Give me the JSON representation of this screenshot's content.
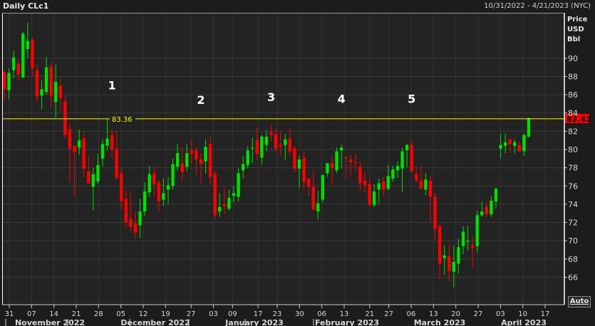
{
  "header": {
    "title": "Daily CLc1",
    "range": "10/31/2022 - 4/21/2023 (NYC)"
  },
  "controls": {
    "auto_label": "Auto"
  },
  "chart_data": {
    "type": "candlestick",
    "title": "Daily CLc1",
    "ylabel": [
      "Price",
      "USD",
      "Bbl"
    ],
    "ylim": [
      64.5,
      92.5
    ],
    "yticks": [
      66,
      68,
      70,
      72,
      74,
      76,
      78,
      80,
      82,
      84,
      86,
      88,
      90
    ],
    "grid": true,
    "colors": {
      "up": "#00e000",
      "down": "#ff0000",
      "hline": "#ffff00",
      "last_price_bg": "#ff0000"
    },
    "xtick_days_from_start": [
      0,
      7,
      14,
      21,
      28,
      35,
      42,
      49,
      57,
      64,
      70,
      78,
      84,
      91,
      98,
      105,
      113,
      119,
      126,
      133,
      140,
      147,
      154,
      161,
      168
    ],
    "xtick_labels": [
      "31",
      "07",
      "14",
      "21",
      "28",
      "05",
      "12",
      "19",
      "27",
      "03",
      "09",
      "17",
      "23",
      "30",
      "06",
      "13",
      "21",
      "27",
      "06",
      "13",
      "20",
      "27",
      "03",
      "10",
      "17"
    ],
    "months": [
      "November 2022",
      "December 2022",
      "January 2023",
      "February 2023",
      "March 2023",
      "April 2023"
    ],
    "hline": {
      "value": 83.36,
      "label": "83.36"
    },
    "last_price": {
      "value": 83.43,
      "label": "83.43"
    },
    "annotations": [
      {
        "text": "1",
        "candle": 23,
        "price": 86.6
      },
      {
        "text": "2",
        "candle": 42,
        "price": 85.0
      },
      {
        "text": "3",
        "candle": 57,
        "price": 85.3
      },
      {
        "text": "4",
        "candle": 72,
        "price": 85.1
      },
      {
        "text": "5",
        "candle": 87,
        "price": 85.1
      }
    ],
    "ohlc_fields": [
      "open",
      "high",
      "low",
      "close"
    ],
    "candles": [
      [
        88.5,
        88.7,
        85.3,
        86.6
      ],
      [
        86.5,
        88.9,
        85.5,
        88.4
      ],
      [
        88.7,
        90.8,
        87.8,
        90.1
      ],
      [
        89.4,
        89.9,
        87.5,
        88.2
      ],
      [
        87.9,
        92.9,
        87.8,
        92.7
      ],
      [
        91,
        93.9,
        90,
        91.9
      ],
      [
        92,
        92.3,
        88,
        88.9
      ],
      [
        88.7,
        89.3,
        85.3,
        85.8
      ],
      [
        85.9,
        87.6,
        84.4,
        86.6
      ],
      [
        86.3,
        90.1,
        86,
        89
      ],
      [
        89.1,
        89.6,
        84.6,
        85.9
      ],
      [
        85.2,
        89.3,
        83.5,
        87.4
      ],
      [
        87,
        87.7,
        84.2,
        85.6
      ],
      [
        85.3,
        86,
        81.2,
        81.6
      ],
      [
        82.2,
        82.9,
        76.4,
        80.1
      ],
      [
        80.4,
        80.4,
        74.8,
        79.7
      ],
      [
        80.2,
        82.2,
        79.4,
        81
      ],
      [
        81.2,
        82,
        77,
        77.9
      ],
      [
        77.6,
        79.2,
        76.2,
        76.3
      ],
      [
        75.9,
        78,
        73.3,
        77.3
      ],
      [
        76.5,
        79.5,
        76.2,
        78.3
      ],
      [
        79,
        81.1,
        78.2,
        80.6
      ],
      [
        80.4,
        83.36,
        79.9,
        81.2
      ],
      [
        81.6,
        82.2,
        79,
        80
      ],
      [
        80.1,
        82.1,
        76.7,
        76.9
      ],
      [
        77.4,
        78,
        73.4,
        74.3
      ],
      [
        74.6,
        75.5,
        71.5,
        72
      ],
      [
        72.4,
        75.5,
        70.9,
        71.5
      ],
      [
        71.9,
        73.2,
        70.2,
        70.9
      ],
      [
        71.7,
        74.6,
        70.3,
        73.2
      ],
      [
        73.2,
        76.4,
        72.7,
        75.4
      ],
      [
        75.3,
        78.2,
        74.8,
        77.3
      ],
      [
        77.4,
        78.2,
        74.8,
        76.2
      ],
      [
        76.4,
        76.7,
        73.2,
        74.3
      ],
      [
        74.5,
        76.8,
        73.8,
        75.2
      ],
      [
        75.6,
        77,
        74,
        76.1
      ],
      [
        76,
        79,
        75.6,
        78.4
      ],
      [
        78.1,
        80.6,
        77.7,
        79.6
      ],
      [
        78.5,
        80.3,
        76.6,
        77.5
      ],
      [
        78.1,
        80.6,
        77.6,
        79.6
      ],
      [
        79.9,
        81,
        78.5,
        79.5
      ],
      [
        79.9,
        80.2,
        77.2,
        78.9
      ],
      [
        78.9,
        79.6,
        76.2,
        78.4
      ],
      [
        78.7,
        81.1,
        77.4,
        80.3
      ],
      [
        80.6,
        81.4,
        76.2,
        77
      ],
      [
        77.3,
        77.7,
        72.4,
        72.8
      ],
      [
        73.2,
        75.2,
        72.6,
        73.7
      ],
      [
        74,
        75.8,
        72.9,
        73.8
      ],
      [
        73.5,
        75.6,
        73.3,
        74.7
      ],
      [
        74.9,
        76,
        74.2,
        75.2
      ],
      [
        74.8,
        78,
        74.3,
        77.4
      ],
      [
        77.7,
        79.3,
        76.8,
        78.4
      ],
      [
        78.3,
        80.4,
        77.9,
        79.9
      ],
      [
        80.1,
        81.3,
        78.5,
        80.2
      ],
      [
        81,
        82.4,
        78.9,
        79.5
      ],
      [
        79.1,
        81.6,
        78.4,
        81.4
      ],
      [
        80.5,
        82.1,
        79.8,
        81.4
      ],
      [
        81.9,
        82.7,
        80.9,
        81.6
      ],
      [
        81.7,
        82.3,
        79.6,
        80.1
      ],
      [
        80.5,
        82.1,
        79.3,
        80.3
      ],
      [
        80.5,
        81.7,
        78.8,
        81.1
      ],
      [
        81.2,
        82.2,
        79.4,
        79.8
      ],
      [
        80.1,
        80.4,
        77.5,
        77.9
      ],
      [
        77.9,
        79.3,
        75.8,
        78.9
      ],
      [
        79.1,
        79.7,
        75.6,
        76.4
      ],
      [
        76.8,
        76.9,
        74.9,
        75.9
      ],
      [
        75.9,
        77.6,
        73.3,
        73.4
      ],
      [
        73.2,
        75.5,
        72.3,
        74.1
      ],
      [
        74.5,
        77.2,
        74.2,
        77.2
      ],
      [
        77.4,
        78.5,
        77,
        78.5
      ],
      [
        78.5,
        79.2,
        76.1,
        78
      ],
      [
        77.7,
        80.2,
        77.4,
        79.8
      ],
      [
        79.9,
        80.5,
        77.9,
        80.2
      ],
      [
        79.15,
        79.3,
        76.9,
        79.1
      ],
      [
        78.9,
        79.4,
        77.2,
        78.6
      ],
      [
        78.6,
        79.5,
        77.7,
        78.5
      ],
      [
        78.1,
        78.7,
        75.5,
        76.3
      ],
      [
        76.6,
        77.6,
        75.3,
        76.1
      ],
      [
        76.2,
        76.9,
        73.8,
        73.9
      ],
      [
        73.9,
        76.2,
        73.7,
        75.4
      ],
      [
        75.6,
        76.8,
        74.1,
        76.3
      ],
      [
        76.5,
        77,
        74.8,
        75.6
      ],
      [
        75.7,
        78.3,
        75.5,
        77.1
      ],
      [
        76.8,
        78.2,
        76.5,
        77.8
      ],
      [
        77.7,
        78.7,
        76.9,
        78.2
      ],
      [
        77.9,
        80.2,
        75.3,
        79.8
      ],
      [
        79.9,
        80.6,
        78.1,
        80.5
      ],
      [
        80.5,
        81,
        77.6,
        77.6
      ],
      [
        77.3,
        78.1,
        76.4,
        76.6
      ],
      [
        76.6,
        78.2,
        75.8,
        75.7
      ],
      [
        75.6,
        77.4,
        75,
        76.7
      ],
      [
        76.6,
        77.1,
        72.2,
        74.8
      ],
      [
        74.8,
        75.2,
        70.1,
        71.3
      ],
      [
        71.6,
        71.8,
        65.8,
        67.5
      ],
      [
        68.1,
        69.5,
        66.3,
        68.4
      ],
      [
        68.3,
        69.6,
        65.6,
        66.7
      ],
      [
        66.6,
        69.5,
        64.9,
        67.7
      ],
      [
        67.5,
        70.2,
        66.4,
        69.3
      ],
      [
        69.4,
        71.6,
        68.5,
        71
      ],
      [
        69.9,
        71.6,
        68.9,
        70
      ],
      [
        69.5,
        70.4,
        67.1,
        69.2
      ],
      [
        69.4,
        73.3,
        68.7,
        72.8
      ],
      [
        72.8,
        74.3,
        72.6,
        73.2
      ],
      [
        73.7,
        74.3,
        72.6,
        72.9
      ],
      [
        72.9,
        74.9,
        72.6,
        74.4
      ],
      [
        74.3,
        75.8,
        73.5,
        75.7
      ],
      [
        80.1,
        81.7,
        79,
        80.5
      ],
      [
        80.4,
        81.8,
        79.6,
        80.8
      ],
      [
        81.1,
        81.3,
        79.6,
        80.6
      ],
      [
        80.4,
        81.1,
        79.6,
        80.8
      ],
      [
        80.5,
        80.9,
        79.8,
        79.8
      ],
      [
        79.8,
        81.7,
        79.3,
        81.6
      ],
      [
        81.4,
        83.5,
        81.3,
        83.43
      ]
    ]
  }
}
